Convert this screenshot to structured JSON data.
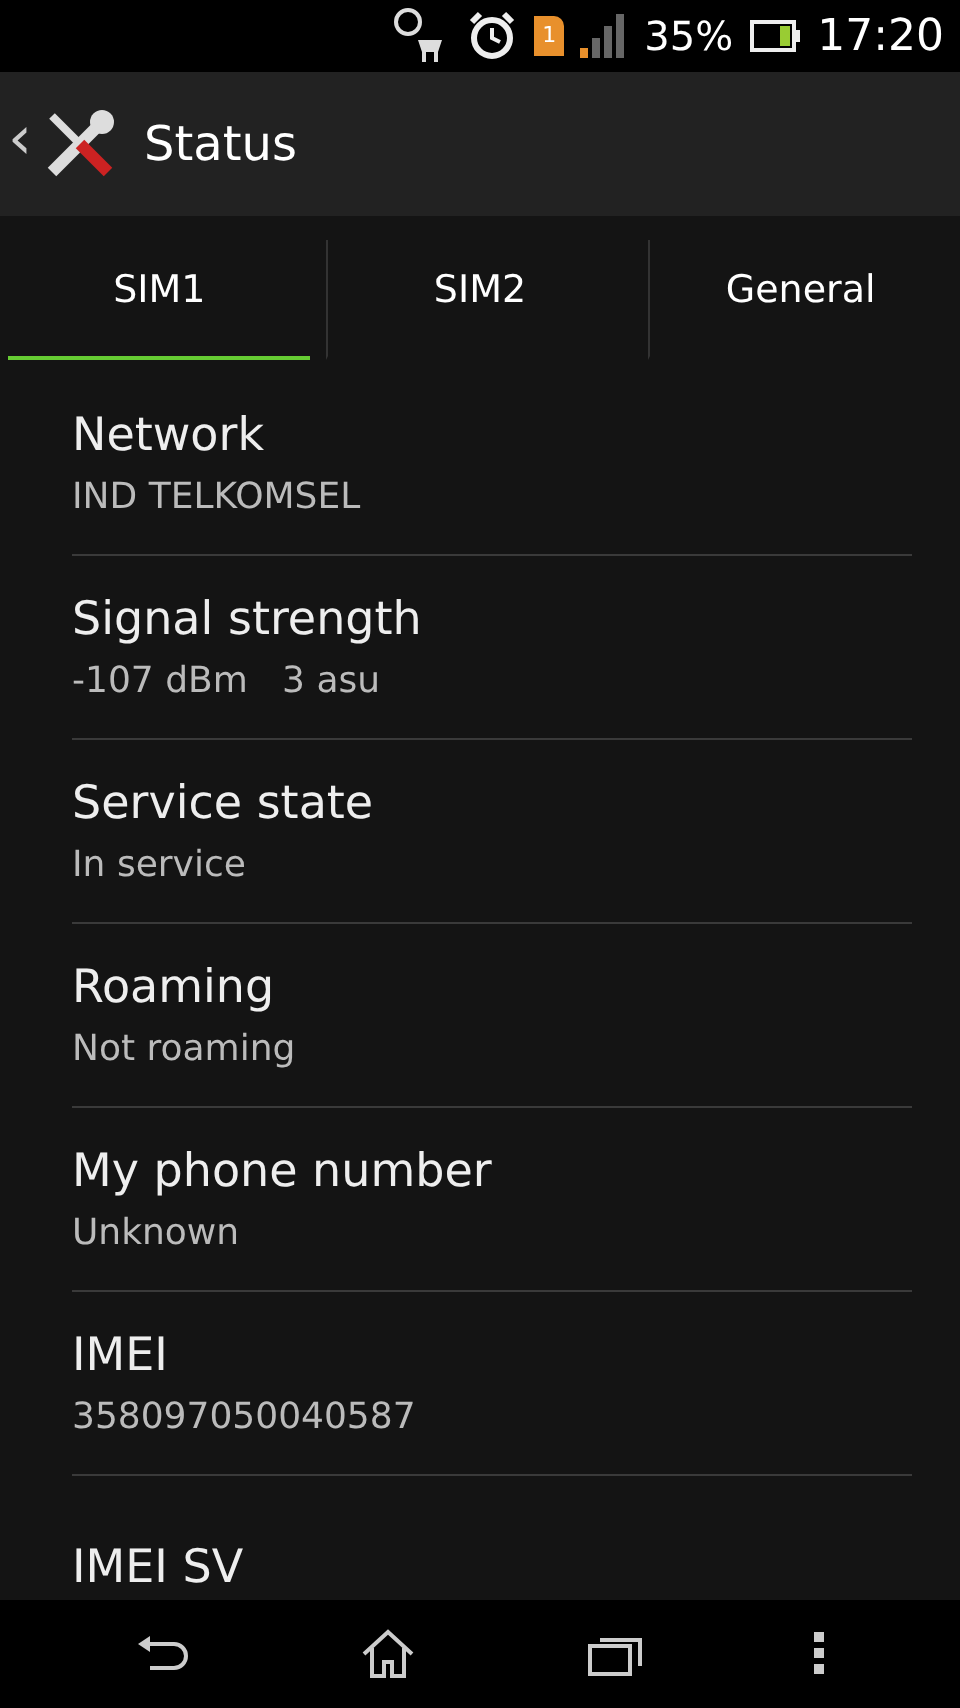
{
  "status_bar": {
    "battery": "35%",
    "time": "17:20",
    "sim_badge": "1"
  },
  "action_bar": {
    "back": "‹",
    "title": "Status"
  },
  "tabs": [
    {
      "label": "SIM1",
      "selected": true
    },
    {
      "label": "SIM2",
      "selected": false
    },
    {
      "label": "General",
      "selected": false
    }
  ],
  "items": [
    {
      "title": "Network",
      "value": "IND TELKOMSEL"
    },
    {
      "title": "Signal strength",
      "value": "-107 dBm   3 asu"
    },
    {
      "title": "Service state",
      "value": "In service"
    },
    {
      "title": "Roaming",
      "value": "Not roaming"
    },
    {
      "title": "My phone number",
      "value": "Unknown"
    },
    {
      "title": "IMEI",
      "value": "358097050040587"
    },
    {
      "title": "IMEI SV"
    }
  ]
}
